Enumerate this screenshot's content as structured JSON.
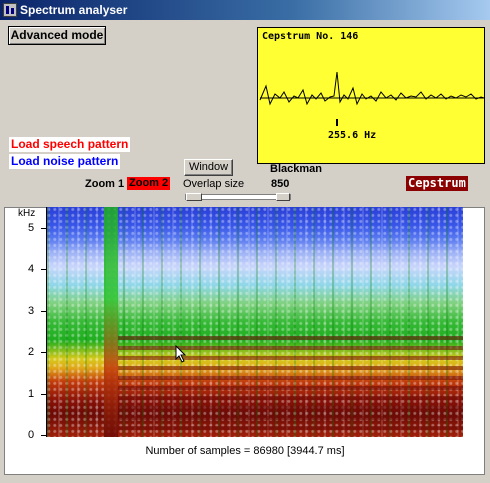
{
  "window": {
    "title": "Spectrum analyser"
  },
  "toolbar": {
    "advanced_label": "Advanced mode"
  },
  "cepstrum": {
    "title": "Cepstrum No. 146",
    "frequency": "255.6 Hz",
    "toggle_label": "Cepstrum"
  },
  "patterns": {
    "speech_label": "Load speech pattern",
    "noise_label": "Load noise pattern"
  },
  "zoom": {
    "zoom1_label": "Zoom 1",
    "zoom2_label": "Zoom 2"
  },
  "window_fn": {
    "button_label": "Window",
    "name": "Blackman",
    "overlap_label": "Overlap size",
    "overlap_value": "850"
  },
  "spectrogram": {
    "unit": "kHz",
    "ticks": [
      "5",
      "4",
      "3",
      "2",
      "1",
      "0"
    ],
    "samples_text": "Number of samples = 86980 [3944.7 ms]"
  },
  "colors": {
    "cepstrum_bg": "#ffff33",
    "speech": "#ff0000",
    "noise": "#0000ff",
    "zoom_active": "#ff0000",
    "cepstrum_toggle": "#8b0000"
  }
}
